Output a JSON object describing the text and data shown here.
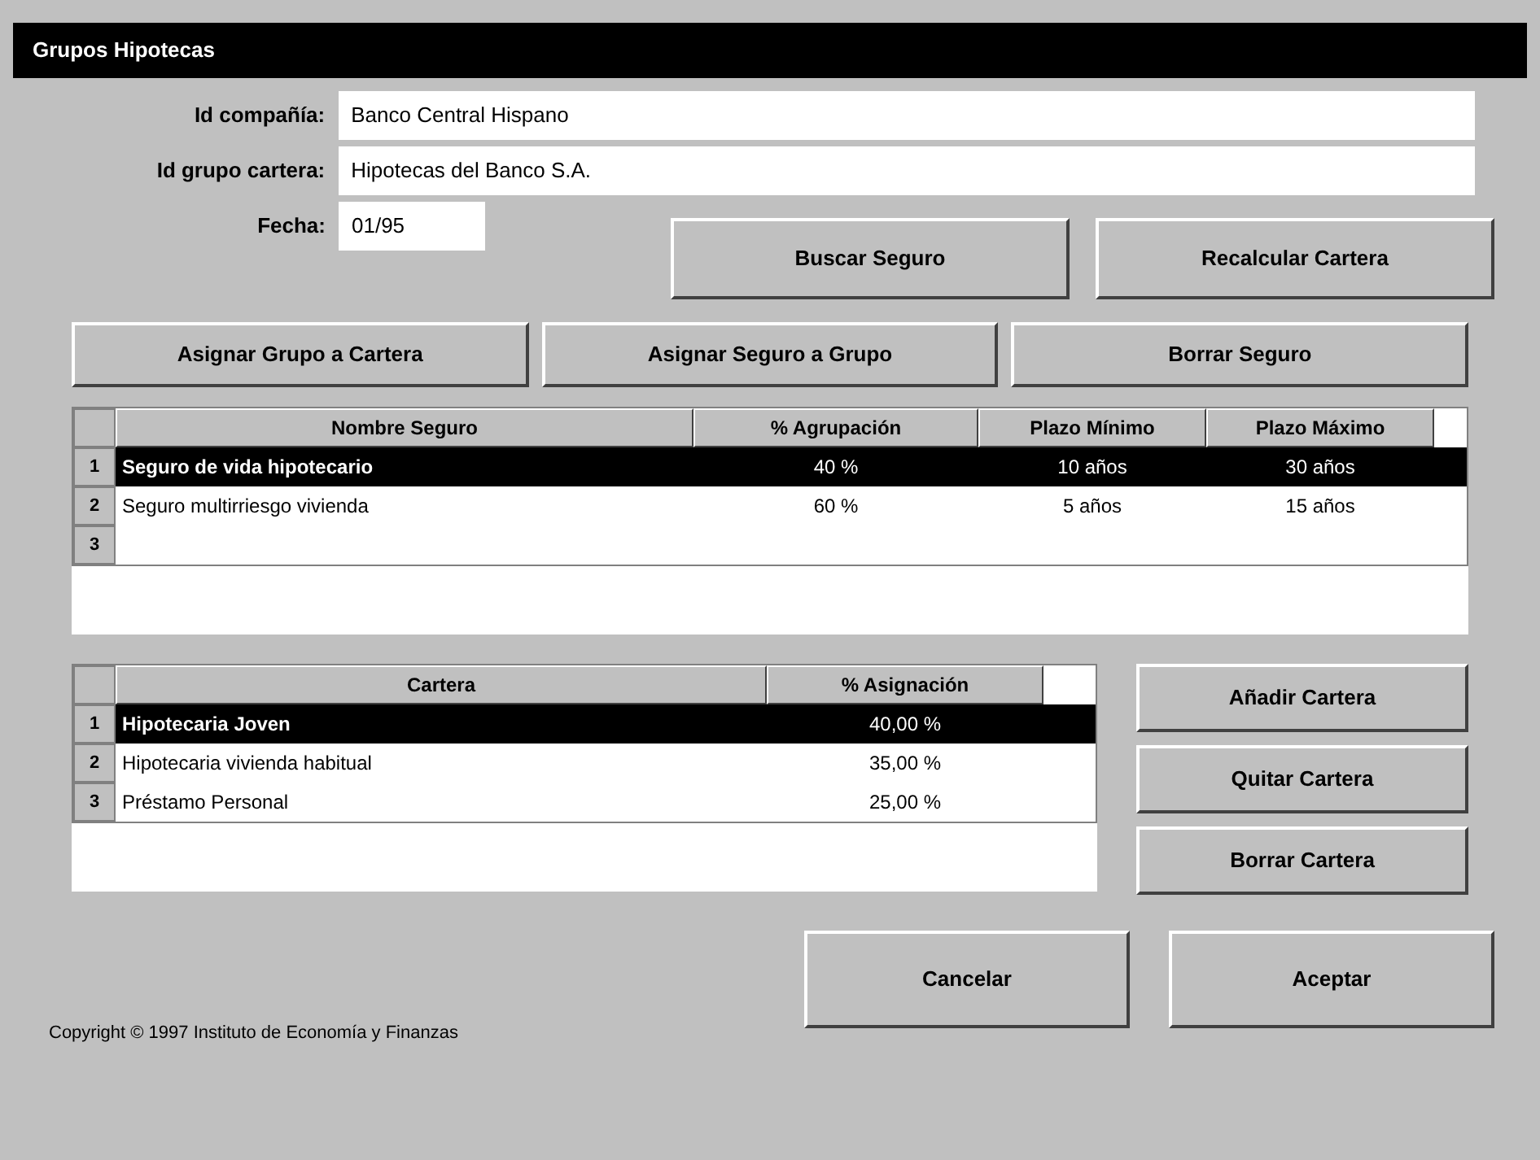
{
  "window": {
    "title": "Grupos Hipotecas"
  },
  "fields": [
    {
      "label": "Id compañía:",
      "value": "Banco Central Hispano"
    },
    {
      "label": "Id grupo cartera:",
      "value": "Hipotecas del Banco S.A."
    },
    {
      "label": "Fecha:",
      "value": "01/95"
    }
  ],
  "top_buttons": [
    "Buscar Seguro",
    "Recalcular Cartera"
  ],
  "action_buttons": [
    "Asignar Grupo a Cartera",
    "Asignar Seguro a Grupo",
    "Borrar Seguro"
  ],
  "insurance_table": {
    "columns": [
      "Nombre Seguro",
      "% Agrupación",
      "Plazo Mínimo",
      "Plazo Máximo"
    ],
    "rows": [
      {
        "marker": "1",
        "cells": [
          "Seguro de vida hipotecario",
          "40 %",
          "10 años",
          "30 años"
        ],
        "selected": true
      },
      {
        "marker": "2",
        "cells": [
          "Seguro multirriesgo vivienda",
          "60 %",
          "5 años",
          "15 años"
        ],
        "selected": false
      },
      {
        "marker": "3",
        "cells": [],
        "selected": false
      }
    ]
  },
  "portfolio_table": {
    "columns": [
      "Cartera",
      "% Asignación"
    ],
    "rows": [
      {
        "marker": "1",
        "cells": [
          "Hipotecaria Joven",
          "40,00 %"
        ],
        "selected": true
      },
      {
        "marker": "2",
        "cells": [
          "Hipotecaria vivienda habitual",
          "35,00 %"
        ],
        "selected": false
      },
      {
        "marker": "3",
        "cells": [
          "Préstamo Personal",
          "25,00 %"
        ],
        "selected": false
      }
    ]
  },
  "side_buttons": [
    "Añadir Cartera",
    "Quitar Cartera",
    "Borrar Cartera"
  ],
  "dialog_buttons": [
    "Cancelar",
    "Aceptar"
  ],
  "status_bar": "Copyright © 1997 Instituto de Economía y Finanzas"
}
